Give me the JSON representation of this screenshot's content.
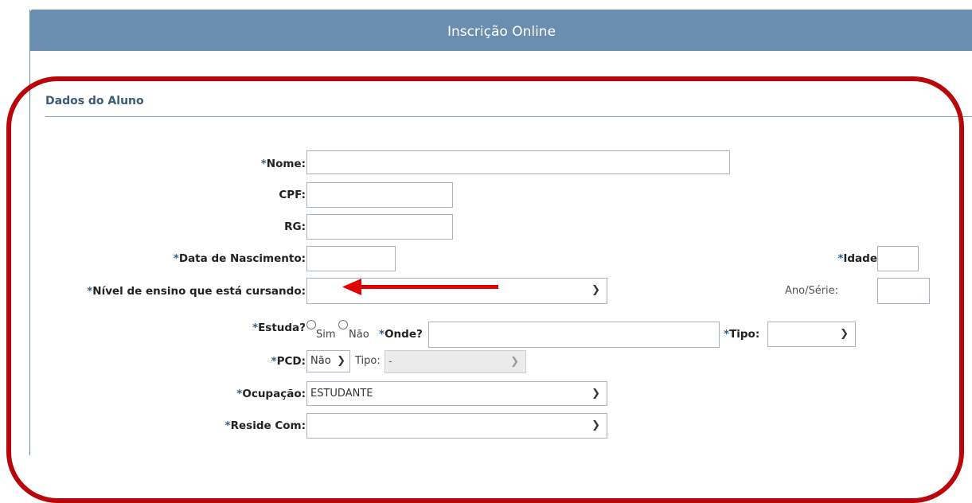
{
  "header": {
    "title": "Inscrição Online"
  },
  "section": {
    "title": "Dados do Aluno"
  },
  "form": {
    "nome": {
      "req": "*",
      "label": "Nome:",
      "value": ""
    },
    "cpf": {
      "label": "CPF:",
      "value": ""
    },
    "rg": {
      "label": "RG:",
      "value": ""
    },
    "data_nascimento": {
      "req": "*",
      "label": "Data de Nascimento:",
      "value": ""
    },
    "idade": {
      "req": "*",
      "label": "Idade",
      "value": ""
    },
    "nivel": {
      "req": "*",
      "label": "Nível de ensino que está cursando:",
      "selected": ""
    },
    "ano_serie": {
      "label": "Ano/Série:",
      "value": ""
    },
    "estuda": {
      "req": "*",
      "label": "Estuda?",
      "options": [
        "Sim",
        "Não"
      ]
    },
    "onde": {
      "req": "*",
      "label": "Onde?",
      "value": ""
    },
    "tipo": {
      "req": "*",
      "label": "Tipo:",
      "selected": ""
    },
    "pcd": {
      "req": "*",
      "label": "PCD:",
      "selected": "Não",
      "tipo_label": "Tipo:",
      "tipo_selected": "-"
    },
    "ocupacao": {
      "req": "*",
      "label": "Ocupação:",
      "selected": "ESTUDANTE"
    },
    "reside": {
      "req": "*",
      "label": "Reside Com:",
      "selected": ""
    }
  },
  "icons": {
    "chevron": "chevron-down-icon",
    "arrow": "red-arrow-left-icon"
  },
  "colors": {
    "header": "#6a8eb0",
    "highlight": "#b8060b",
    "arrow": "#e00000",
    "required": "#2f5f8f"
  }
}
